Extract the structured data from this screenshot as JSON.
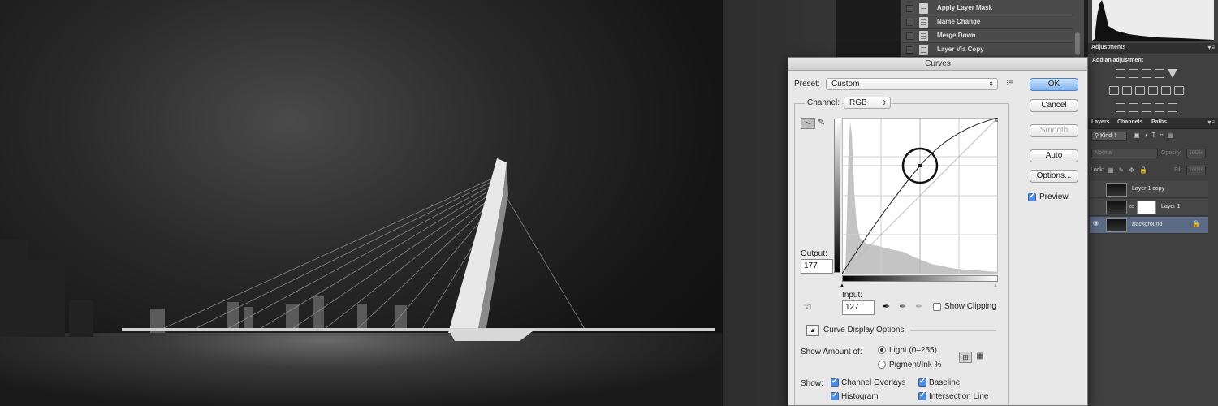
{
  "dialog": {
    "title": "Curves",
    "preset_label": "Preset:",
    "preset_value": "Custom",
    "channel_label": "Channel:",
    "channel_value": "RGB",
    "output_label": "Output:",
    "output_value": "177",
    "input_label": "Input:",
    "input_value": "127",
    "show_clipping": "Show Clipping",
    "curve_display_options": "Curve Display Options",
    "show_amount_of": "Show Amount of:",
    "light": "Light  (0–255)",
    "pigment": "Pigment/Ink %",
    "show_label": "Show:",
    "channel_overlays": "Channel Overlays",
    "baseline": "Baseline",
    "histogram": "Histogram",
    "intersection_line": "Intersection Line",
    "buttons": {
      "ok": "OK",
      "cancel": "Cancel",
      "smooth": "Smooth",
      "auto": "Auto",
      "options": "Options..."
    },
    "preview": "Preview"
  },
  "history": {
    "items": [
      "Apply Layer Mask",
      "Name Change",
      "Merge Down",
      "Layer Via Copy"
    ]
  },
  "adjustments": {
    "tab": "Adjustments",
    "heading": "Add an adjustment"
  },
  "layers_panel": {
    "tabs": [
      "Layers",
      "Channels",
      "Paths"
    ],
    "kind": "Kind",
    "blend_mode": "Normal",
    "opacity_label": "Opacity:",
    "opacity_value": "100%",
    "lock_label": "Lock:",
    "fill_label": "Fill:",
    "fill_value": "100%",
    "layers": [
      {
        "name": "Layer 1 copy"
      },
      {
        "name": "Layer 1"
      },
      {
        "name": "Background"
      }
    ]
  },
  "colors": {
    "accent": "#4d8ce0",
    "selected_layer": "#5b6b85"
  }
}
